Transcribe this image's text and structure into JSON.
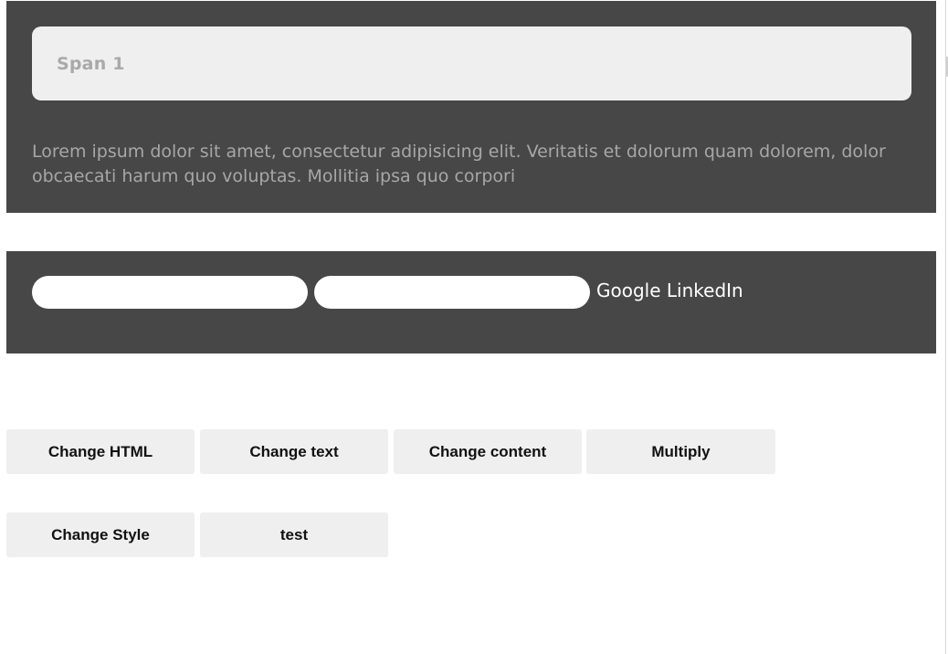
{
  "top_panel": {
    "span_label": "Span 1",
    "paragraph": "Lorem ipsum dolor sit amet, consectetur adipisicing elit. Veritatis et dolorum quam dolorem, dolor obcaecati harum quo voluptas. Mollitia ipsa quo corpori"
  },
  "form_panel": {
    "input_1": {
      "value": "",
      "placeholder": ""
    },
    "input_2": {
      "value": "",
      "placeholder": ""
    },
    "links": [
      "Google",
      "LinkedIn"
    ]
  },
  "buttons": {
    "row1": [
      "Change HTML",
      "Change text",
      "Change content",
      "Multiply"
    ],
    "row2": [
      "Change Style",
      "test"
    ]
  },
  "colors": {
    "panel_background": "#474747",
    "button_background": "#efefef",
    "span_box_background": "#efefef",
    "muted_text": "#a7a7a7"
  }
}
